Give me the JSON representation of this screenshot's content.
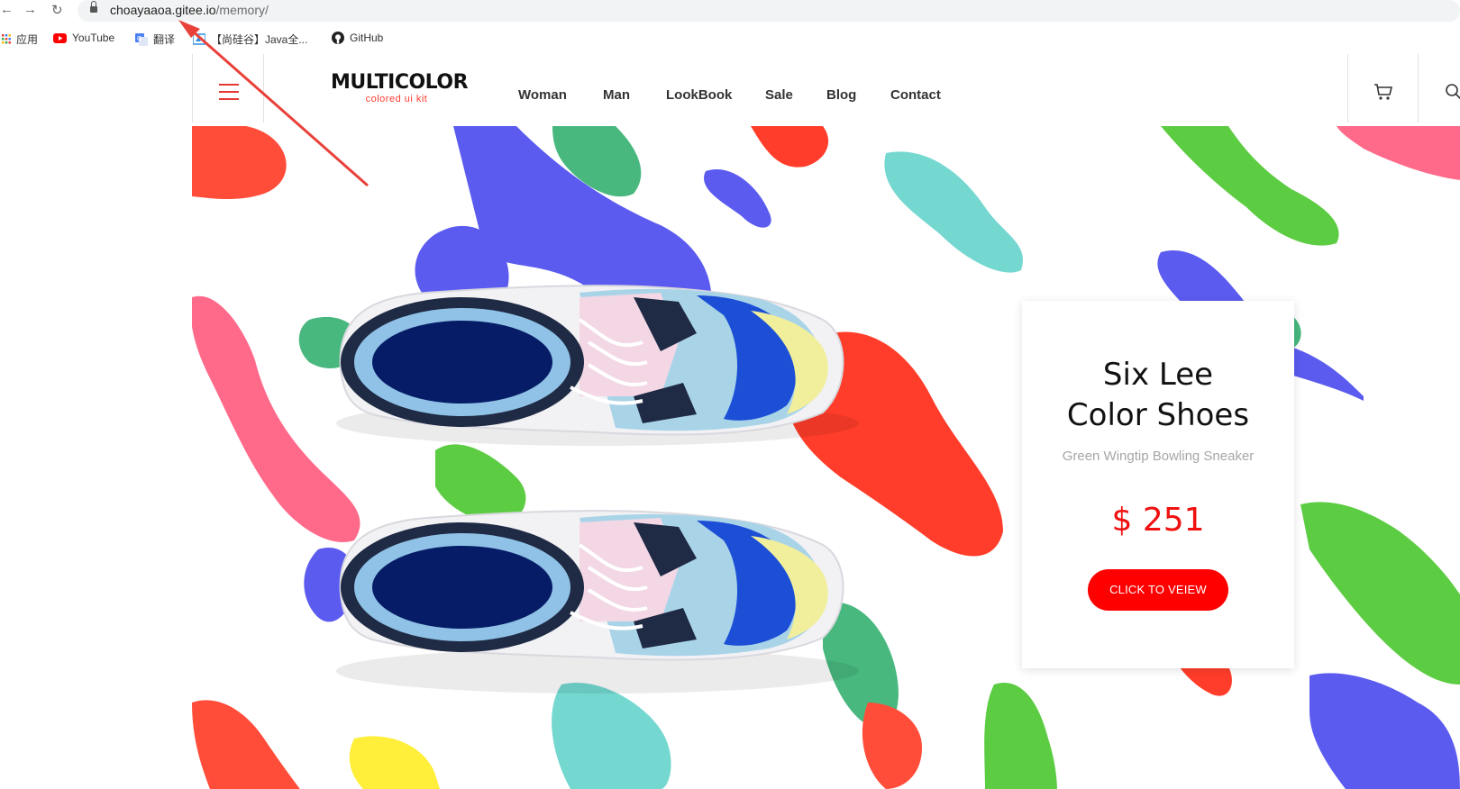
{
  "browser": {
    "url_host": "choayaaoa.gitee.io",
    "url_path": "/memory/",
    "bookmarks": [
      {
        "label": "应用",
        "icon": "apps-grid-icon",
        "color": "#4285f4"
      },
      {
        "label": "YouTube",
        "icon": "youtube-icon",
        "color": "#ff0000"
      },
      {
        "label": "翻译",
        "icon": "translate-icon",
        "color": "#4a80f5"
      },
      {
        "label": "【尚硅谷】Java全...",
        "icon": "bookmark-site-icon",
        "color": "#2c8de0"
      },
      {
        "label": "GitHub",
        "icon": "github-icon",
        "color": "#222222"
      }
    ]
  },
  "site": {
    "logo_title": "MULTICOLOR",
    "logo_subtitle": "colored ui kit",
    "menu": [
      "Woman",
      "Man",
      "LookBook",
      "Sale",
      "Blog",
      "Contact"
    ]
  },
  "product": {
    "name_line1": "Six Lee",
    "name_line2": "Color Shoes",
    "subtitle": "Green Wingtip Bowling Sneaker",
    "price": "$ 251",
    "button_label": "CLICK TO VEIEW"
  },
  "colors": {
    "accent_red": "#ff0000",
    "splash_blue": "#5b5bf0",
    "splash_green": "#48b87e",
    "splash_teal": "#74d8d0",
    "splash_lime": "#5ccc42",
    "splash_pink": "#ff6a8a",
    "splash_orange": "#ff4d3a",
    "splash_yellow": "#ffee3a"
  }
}
